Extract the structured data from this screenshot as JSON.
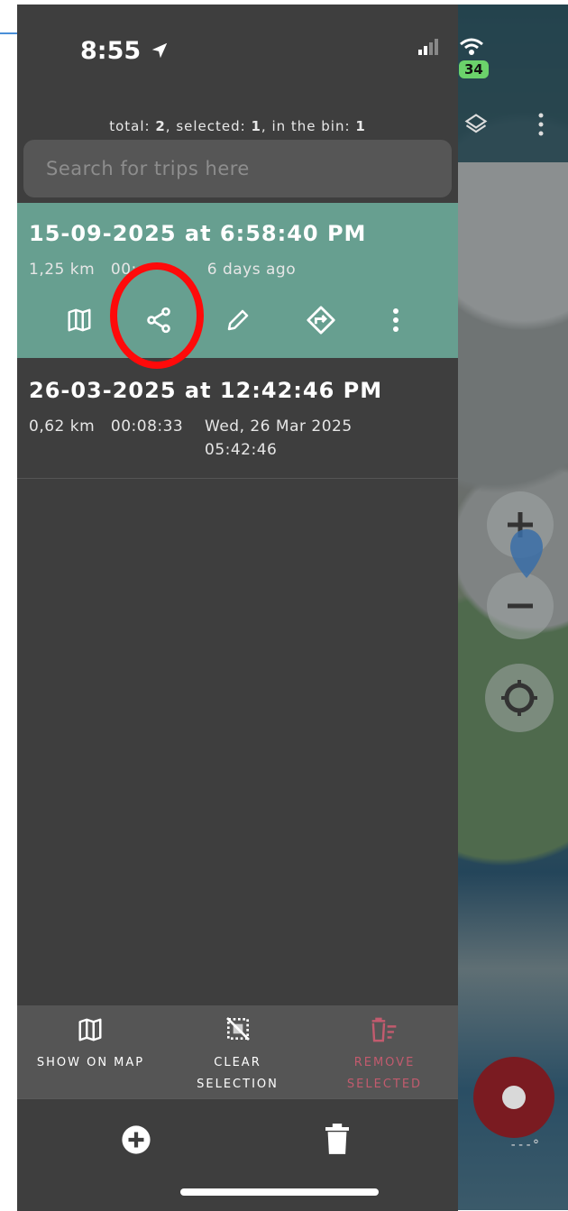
{
  "status": {
    "time": "8:55",
    "battery": "34"
  },
  "summary": {
    "text_prefix": "total: ",
    "total": "2",
    "sep1": ", selected: ",
    "selected": "1",
    "sep2": ", in the bin: ",
    "bin": "1"
  },
  "search": {
    "placeholder": "Search for trips here"
  },
  "trips": [
    {
      "title": "15-09-2025 at 6:58:40 PM",
      "distance": "1,25 km",
      "duration": "00:",
      "when": "6 days ago"
    },
    {
      "title": "26-03-2025 at 12:42:46 PM",
      "distance": "0,62 km",
      "duration": "00:08:33",
      "when_line1": "Wed, 26 Mar 2025",
      "when_line2": "05:42:46"
    }
  ],
  "toolbar": {
    "show_on_map": "SHOW ON MAP",
    "clear_line1": "CLEAR",
    "clear_line2": "SELECTION",
    "remove_line1": "REMOVE",
    "remove_line2": "SELECTED"
  },
  "map": {
    "distance_label": "---°"
  },
  "colors": {
    "selected_bg": "#679f90",
    "remove": "#c25b6e",
    "highlight": "#ff0a0a"
  },
  "icons": [
    "map-icon",
    "share-icon",
    "pencil-icon",
    "directions-icon",
    "more-vert-icon",
    "clear-selection-icon",
    "remove-selected-icon",
    "add-icon",
    "trash-icon",
    "layers-icon"
  ]
}
